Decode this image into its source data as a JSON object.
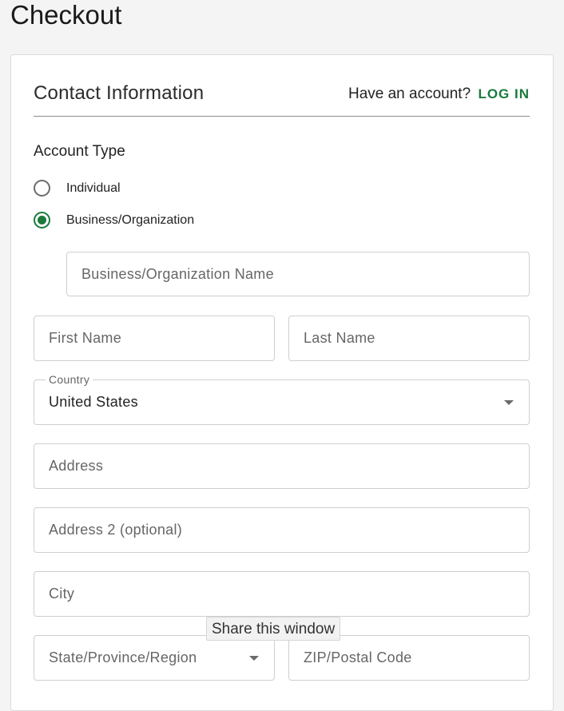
{
  "page": {
    "title": "Checkout"
  },
  "contact": {
    "title": "Contact Information",
    "account_prompt": "Have an account?",
    "login_label": "LOG IN",
    "account_type_label": "Account Type",
    "options": [
      {
        "label": "Individual",
        "selected": false
      },
      {
        "label": "Business/Organization",
        "selected": true
      }
    ]
  },
  "form": {
    "business_name_placeholder": "Business/Organization Name",
    "first_name_placeholder": "First Name",
    "last_name_placeholder": "Last Name",
    "country_label": "Country",
    "country_value": "United States",
    "address_placeholder": "Address",
    "address2_placeholder": "Address 2 (optional)",
    "city_placeholder": "City",
    "state_placeholder": "State/Province/Region",
    "zip_placeholder": "ZIP/Postal Code"
  },
  "tooltip": {
    "text": "Share this window"
  },
  "colors": {
    "accent": "#1a7a3c",
    "background": "#f4f4f4"
  },
  "icons": {
    "dropdown": "chevron-down-icon"
  }
}
